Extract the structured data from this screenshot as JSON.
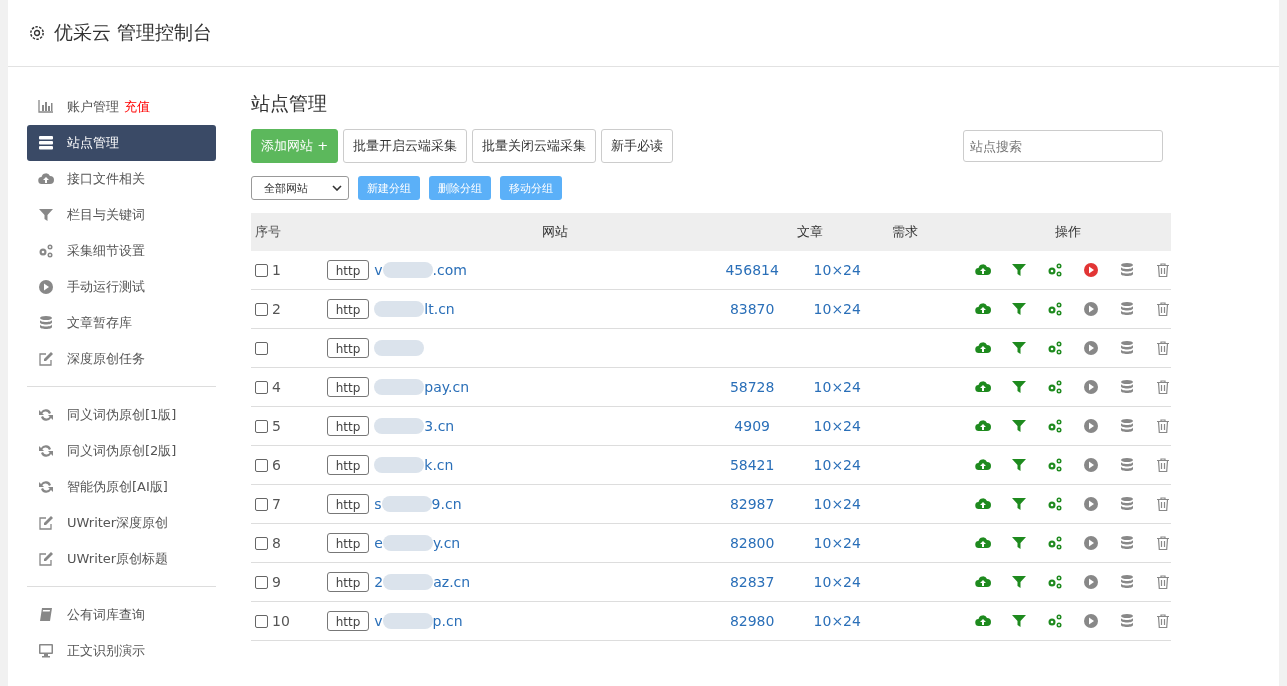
{
  "header": {
    "title": "优采云 管理控制台"
  },
  "sidebar": {
    "groups": [
      {
        "items": [
          {
            "kind": "chart",
            "label": "账户管理",
            "badge": "充值",
            "selected": false
          },
          {
            "kind": "server",
            "label": "站点管理",
            "selected": true
          },
          {
            "kind": "cloud",
            "label": "接口文件相关",
            "selected": false
          },
          {
            "kind": "filter",
            "label": "栏目与关键词",
            "selected": false
          },
          {
            "kind": "gears",
            "label": "采集细节设置",
            "selected": false
          },
          {
            "kind": "play",
            "label": "手动运行测试",
            "selected": false
          },
          {
            "kind": "database",
            "label": "文章暂存库",
            "selected": false
          },
          {
            "kind": "edit",
            "label": "深度原创任务",
            "selected": false
          }
        ]
      },
      {
        "items": [
          {
            "kind": "refresh",
            "label": "同义词伪原创[1版]",
            "selected": false
          },
          {
            "kind": "refresh",
            "label": "同义词伪原创[2版]",
            "selected": false
          },
          {
            "kind": "refresh",
            "label": "智能伪原创[AI版]",
            "selected": false
          },
          {
            "kind": "edit",
            "label": "UWriter深度原创",
            "selected": false
          },
          {
            "kind": "edit",
            "label": "UWriter原创标题",
            "selected": false
          }
        ]
      },
      {
        "items": [
          {
            "kind": "book",
            "label": "公有词库查询",
            "selected": false
          },
          {
            "kind": "monitor",
            "label": "正文识别演示",
            "selected": false
          }
        ]
      }
    ]
  },
  "main": {
    "title": "站点管理",
    "toolbar": [
      {
        "label": "添加网站 +",
        "kind": "primary"
      },
      {
        "label": "批量开启云端采集",
        "kind": "default"
      },
      {
        "label": "批量关闭云端采集",
        "kind": "default"
      },
      {
        "label": "新手必读",
        "kind": "default"
      }
    ],
    "search": {
      "placeholder": "站点搜索"
    },
    "group_select": {
      "value": "全部网站"
    },
    "group_buttons": [
      "新建分组",
      "删除分组",
      "移动分组"
    ],
    "table": {
      "columns": [
        "序号",
        "网站",
        "文章",
        "需求",
        "操作"
      ],
      "rows": [
        {
          "checked": false,
          "number": "1",
          "protocol": "http",
          "site_start": "v",
          "site_end": ".com",
          "articles": "456814",
          "demand": "10×24",
          "running": true
        },
        {
          "checked": false,
          "number": "2",
          "protocol": "http",
          "site_end": "lt.cn",
          "articles": "83870",
          "demand": "10×24",
          "running": false
        },
        {
          "checked": false,
          "protocol": "http",
          "running": false
        },
        {
          "checked": false,
          "number": "4",
          "protocol": "http",
          "site_end": "pay.cn",
          "articles": "58728",
          "demand": "10×24",
          "running": false
        },
        {
          "checked": false,
          "number": "5",
          "protocol": "http",
          "site_end": "3.cn",
          "articles": "4909",
          "demand": "10×24",
          "running": false
        },
        {
          "checked": false,
          "number": "6",
          "protocol": "http",
          "site_end": "k.cn",
          "articles": "58421",
          "demand": "10×24",
          "running": false
        },
        {
          "checked": false,
          "number": "7",
          "protocol": "http",
          "site_start": "s",
          "site_end": "9.cn",
          "articles": "82987",
          "demand": "10×24",
          "running": false
        },
        {
          "checked": false,
          "number": "8",
          "protocol": "http",
          "site_start": "e",
          "site_end": "y.cn",
          "articles": "82800",
          "demand": "10×24",
          "running": false
        },
        {
          "checked": false,
          "number": "9",
          "protocol": "http",
          "site_start": "2",
          "site_end": "az.cn",
          "articles": "82837",
          "demand": "10×24",
          "running": false
        },
        {
          "checked": false,
          "number": "10",
          "protocol": "http",
          "site_start": "v",
          "site_end": "p.cn",
          "articles": "82980",
          "demand": "10×24",
          "running": false
        }
      ]
    }
  }
}
